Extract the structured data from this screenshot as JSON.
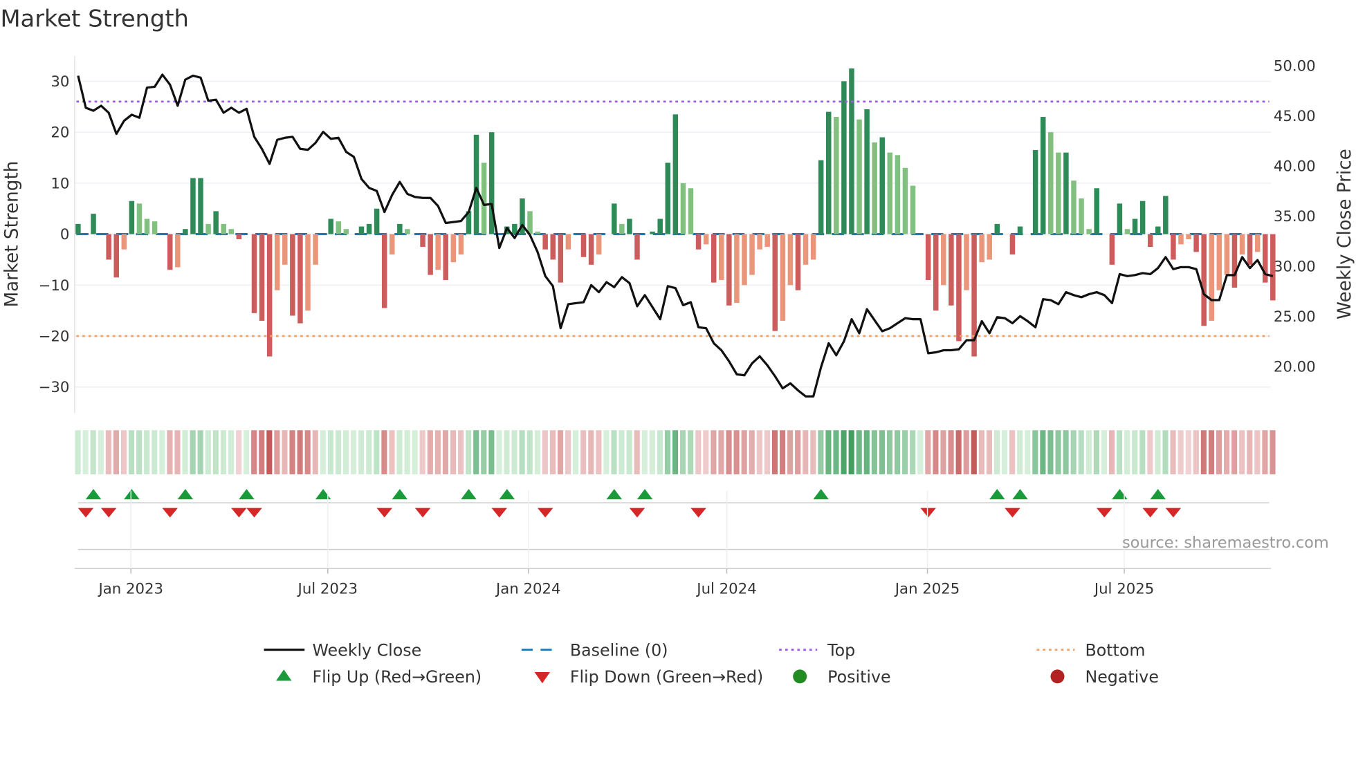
{
  "chart_data": {
    "type": "bar",
    "title": "Market Strength",
    "ylabel": "Market Strength",
    "y2label": "Weekly Close Price",
    "ylim": [
      -35,
      35
    ],
    "y2lim": [
      16.4,
      51
    ],
    "yticks": [
      "30",
      "20",
      "10",
      "0",
      "−10",
      "−20",
      "−30"
    ],
    "ytick_values": [
      30,
      20,
      10,
      0,
      -10,
      -20,
      -30
    ],
    "y2ticks": [
      "50.00",
      "45.00",
      "40.00",
      "35.00",
      "30.00",
      "25.00",
      "20.00"
    ],
    "y2tick_values": [
      50,
      45,
      40,
      35,
      30,
      25,
      20
    ],
    "xticks": [
      "Jan 2023",
      "Jul 2023",
      "Jan 2024",
      "Jul 2024",
      "Jan 2025",
      "Jul 2025"
    ],
    "xtick_week_index": [
      6.9,
      32.6,
      58.8,
      84.7,
      110.9,
      136.6
    ],
    "top_threshold": 26,
    "bottom_threshold": -20,
    "strength": [
      2,
      0,
      4,
      0,
      -5,
      -8.5,
      -3,
      6.5,
      6,
      3,
      2.5,
      0,
      -7,
      -6.5,
      1,
      11,
      11,
      2,
      4.5,
      2,
      1,
      -1,
      0,
      -15.5,
      -17,
      -24,
      -11,
      -6,
      -16,
      -17.5,
      -15,
      -6,
      0,
      3,
      2.5,
      1,
      0,
      1.5,
      2,
      5,
      -14.5,
      -4,
      2,
      1,
      0,
      -2.5,
      -8,
      -7,
      -9,
      -5.5,
      -4,
      4.5,
      19.5,
      14,
      20,
      0,
      1.5,
      2,
      7,
      4.5,
      0.5,
      -3,
      -5,
      -9.5,
      -3,
      0,
      -4.5,
      -6,
      -4,
      0,
      6,
      2,
      3,
      -5,
      0,
      0.5,
      3,
      14,
      23.5,
      10,
      9,
      -3,
      -2,
      -9.5,
      -9,
      -14,
      -13.5,
      -10,
      -8,
      -3,
      -2.5,
      -19,
      -17,
      -10,
      -11,
      -6,
      -5,
      14.5,
      24,
      23,
      30,
      32.5,
      22.5,
      24.5,
      18,
      19,
      16,
      15.5,
      13,
      9.5,
      0,
      -9,
      -15,
      -10,
      -14,
      -21,
      -11,
      -24,
      -5.5,
      -5,
      2,
      0,
      -4,
      1.5,
      0,
      16.5,
      23,
      20,
      16,
      16,
      10.5,
      7,
      1,
      9,
      0,
      -6,
      6,
      1,
      3,
      6.5,
      -2.5,
      1.5,
      7.5,
      -5,
      -2,
      -1,
      -3.5,
      -18,
      -17,
      -11,
      -8,
      -10.5,
      -4,
      -6,
      -3.5,
      -9.5,
      -13
    ],
    "close": [
      49.0,
      45.8,
      45.5,
      46.0,
      45.3,
      43.2,
      44.5,
      45.1,
      44.8,
      47.8,
      47.9,
      49.1,
      48.1,
      46.0,
      48.6,
      49.0,
      48.8,
      46.5,
      46.6,
      45.3,
      45.8,
      45.3,
      45.7,
      42.9,
      41.7,
      40.2,
      42.6,
      42.8,
      42.9,
      41.7,
      41.6,
      42.3,
      43.4,
      42.7,
      42.8,
      41.4,
      40.9,
      38.7,
      37.8,
      37.5,
      35.4,
      37.1,
      38.4,
      37.2,
      36.9,
      36.8,
      36.8,
      36.0,
      34.3,
      34.4,
      34.5,
      35.4,
      37.8,
      36.1,
      36.2,
      31.8,
      33.8,
      32.8,
      34.1,
      33.1,
      31.4,
      29.0,
      28.0,
      23.8,
      26.2,
      26.3,
      26.4,
      28.1,
      27.4,
      28.4,
      27.9,
      28.9,
      28.3,
      26.0,
      27.1,
      25.9,
      24.7,
      28.0,
      27.8,
      26.1,
      26.4,
      23.9,
      23.8,
      22.3,
      21.6,
      20.5,
      19.2,
      19.1,
      20.3,
      21.0,
      20.1,
      19.0,
      17.8,
      18.3,
      17.6,
      17.0,
      17.0,
      19.9,
      22.3,
      21.1,
      22.5,
      24.7,
      23.3,
      25.7,
      24.6,
      23.5,
      23.8,
      24.3,
      24.8,
      24.7,
      24.7,
      21.3,
      21.4,
      21.6,
      21.6,
      21.7,
      22.6,
      22.6,
      24.5,
      23.3,
      24.9,
      24.8,
      24.3,
      25.0,
      24.5,
      23.9,
      26.7,
      26.6,
      26.2,
      27.4,
      27.1,
      26.9,
      27.2,
      27.4,
      27.1,
      26.3,
      29.2,
      29.0,
      29.1,
      29.3,
      29.2,
      29.8,
      30.9,
      29.7,
      29.9,
      29.9,
      29.7,
      27.2,
      26.6,
      26.6,
      29.1,
      29.1,
      30.9,
      29.8,
      30.6,
      29.2,
      29.0
    ],
    "flip_up_week_index": [
      2,
      7,
      14,
      22,
      32,
      42,
      51,
      56,
      70,
      74,
      97,
      120,
      123,
      136,
      141
    ],
    "flip_down_week_index": [
      1,
      4,
      12,
      21,
      23,
      40,
      45,
      55,
      61,
      73,
      81,
      111,
      122,
      134,
      140,
      143
    ],
    "legend": {
      "weekly_close": "Weekly Close",
      "baseline": "Baseline (0)",
      "top": "Top",
      "bottom": "Bottom",
      "flip_up": "Flip Up (Red→Green)",
      "flip_down": "Flip Down (Green→Red)",
      "positive": "Positive",
      "negative": "Negative"
    },
    "legend_placement": "bottom",
    "grid": true,
    "source": "source: sharemaestro.com",
    "colors": {
      "pos_strong": "#2e8b57",
      "pos_weak": "#82c07f",
      "neg_strong": "#cd5c5c",
      "neg_weak": "#e9967a",
      "line": "#111111",
      "baseline": "#1f77b4",
      "top": "#9b5de5",
      "bottom": "#f4a261",
      "flip_up": "#1a9a3a",
      "flip_down": "#d62728",
      "positive": "#228b22",
      "negative": "#b22222"
    }
  }
}
